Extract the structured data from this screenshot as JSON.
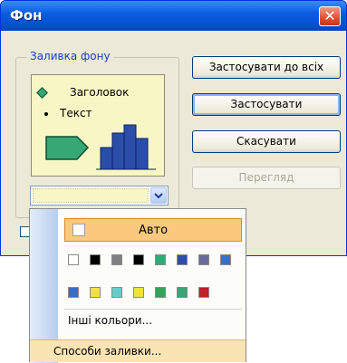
{
  "window": {
    "title": "Фон",
    "close_label": "✕"
  },
  "group": {
    "legend": "Заливка фону",
    "preview": {
      "heading": "Заголовок",
      "bullet_text": "Текст"
    }
  },
  "buttons": {
    "apply_all": "Застосувати до всіх",
    "apply": "Застосувати",
    "cancel": "Скасувати",
    "preview": "Перегляд"
  },
  "combo": {
    "selected_color": "#f8f6c4"
  },
  "popup": {
    "auto_label": "Авто",
    "row1_colors": [
      "#ffffff",
      "#000000",
      "#808080",
      "#000000",
      "#36a876",
      "#2b4ea8",
      "#6a6a9a",
      "#2f74d0"
    ],
    "row2_colors": [
      "#2f6fd0",
      "#f0e040",
      "#66ccc8",
      "#f0e040",
      "#37a05a",
      "#36a876",
      "#c02028"
    ],
    "other_colors": "Інші кольори...",
    "fill_methods": "Способи заливки..."
  },
  "icons": {
    "close": "close-icon",
    "dropdown": "chevron-down-icon"
  }
}
